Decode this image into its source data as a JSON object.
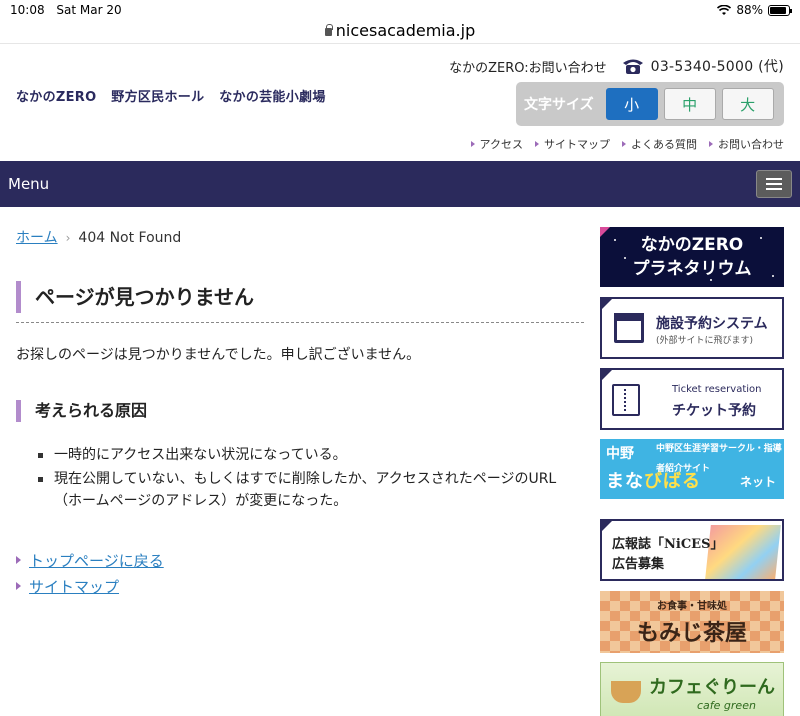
{
  "status_bar": {
    "time": "10:08",
    "date": "Sat Mar 20",
    "battery": "88%",
    "battery_level": 0.88
  },
  "url_bar": {
    "url": "nicesacademia.jp"
  },
  "header": {
    "site_names": [
      "なかのZERO",
      "野方区民ホール",
      "なかの芸能小劇場"
    ],
    "inquiry": "なかのZERO:お問い合わせ",
    "phone": "03-5340-5000 (代)",
    "font_size": {
      "label": "文字サイズ",
      "small": "小",
      "medium": "中",
      "large": "大",
      "selected": "小"
    },
    "util_links": [
      "アクセス",
      "サイトマップ",
      "よくある質問",
      "お問い合わせ"
    ]
  },
  "menu": {
    "label": "Menu"
  },
  "breadcrumb": {
    "home": "ホーム",
    "current": "404 Not Found"
  },
  "main": {
    "heading": "ページが見つかりません",
    "intro": "お探しのページは見つかりませんでした。申し訳ございません。",
    "reasons_heading": "考えられる原因",
    "reasons": [
      "一時的にアクセス出来ない状況になっている。",
      "現在公開していない、もしくはすでに削除したか、アクセスされたページのURL（ホームページのアドレス）が変更になった。"
    ],
    "links": [
      "トップページに戻る",
      "サイトマップ"
    ]
  },
  "sidebar": {
    "planetarium": {
      "line1": "なかのZERO",
      "line2": "プラネタリウム"
    },
    "reservation": {
      "title": "施設予約システム",
      "sub": "(外部サイトに飛びます)"
    },
    "ticket": {
      "en": "Ticket reservation",
      "ja": "チケット予約"
    },
    "manabi": {
      "nakano": "中野",
      "top": "中野区生涯学習サークル・指導者紹介サイト",
      "title_a": "まな",
      "title_b": "びばる",
      "net": "ネット"
    },
    "nices": {
      "line1": "広報誌「NiCES」",
      "line2": "広告募集"
    },
    "momiji": {
      "line1": "お食事・甘味処",
      "line2": "もみじ茶屋"
    },
    "cafe": {
      "title": "カフェぐりーん",
      "sub": "cafe green"
    }
  }
}
